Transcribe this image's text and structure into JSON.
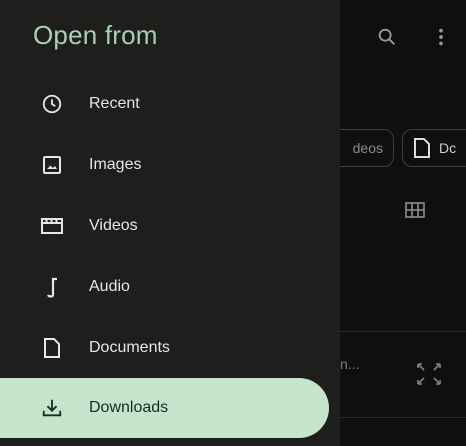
{
  "drawer": {
    "title": "Open from",
    "items": [
      {
        "label": "Recent",
        "icon": "clock-icon",
        "selected": false
      },
      {
        "label": "Images",
        "icon": "image-icon",
        "selected": false
      },
      {
        "label": "Videos",
        "icon": "movie-icon",
        "selected": false
      },
      {
        "label": "Audio",
        "icon": "music-note-icon",
        "selected": false
      },
      {
        "label": "Documents",
        "icon": "document-icon",
        "selected": false
      },
      {
        "label": "Downloads",
        "icon": "download-icon",
        "selected": true
      }
    ]
  },
  "background": {
    "top_icons": [
      "search-icon",
      "more-vert-icon"
    ],
    "chips": [
      {
        "label": "deos",
        "icon": ""
      },
      {
        "label": "Dc",
        "icon": "document-icon"
      }
    ],
    "file_name": "n...",
    "view_toggle_icon": "grid-view-icon",
    "expand_icon": "expand-icon"
  },
  "colors": {
    "drawer_bg": "#1e1f1c",
    "title": "#a9d0b3",
    "selected_bg": "#c5e4cc",
    "text": "#e6e6e6"
  }
}
